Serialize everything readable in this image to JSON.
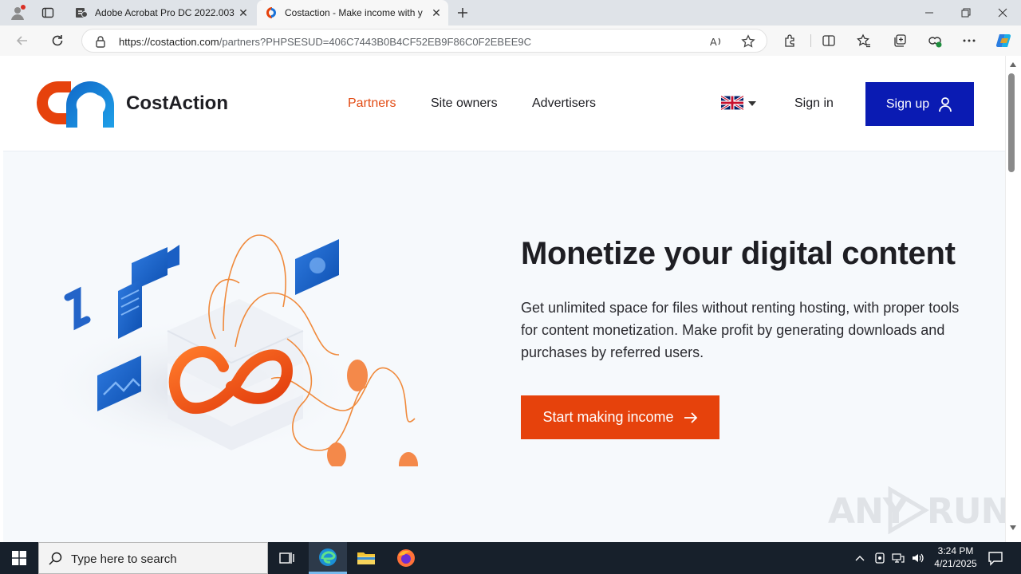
{
  "browser": {
    "tabs": [
      {
        "title": "Adobe Acrobat Pro DC 2022.003.",
        "active": false
      },
      {
        "title": "Costaction - Make income with y",
        "active": true
      }
    ],
    "url_domain": "https://costaction.com",
    "url_path": "/partners?PHPSESUD=406C7443B0B4CF52EB9F86C0F2EBEE9C"
  },
  "site": {
    "brand": "CostAction",
    "nav": [
      "Partners",
      "Site owners",
      "Advertisers"
    ],
    "active_nav": "Partners",
    "sign_in": "Sign in",
    "sign_up": "Sign up",
    "language_flag": "uk-flag-icon"
  },
  "hero": {
    "title": "Monetize your digital content",
    "text": "Get unlimited space for files without renting hosting, with proper tools for content monetization. Make profit by generating downloads and purchases by referred users.",
    "cta": "Start making income"
  },
  "watermark": {
    "left": "ANY",
    "right": "RUN"
  },
  "taskbar": {
    "search_placeholder": "Type here to search",
    "time": "3:24 PM",
    "date": "4/21/2025"
  },
  "colors": {
    "accent_orange": "#e6420c",
    "nav_active": "#e24a12",
    "signup_blue": "#0a1bb3",
    "page_bg": "#f6f9fc"
  }
}
